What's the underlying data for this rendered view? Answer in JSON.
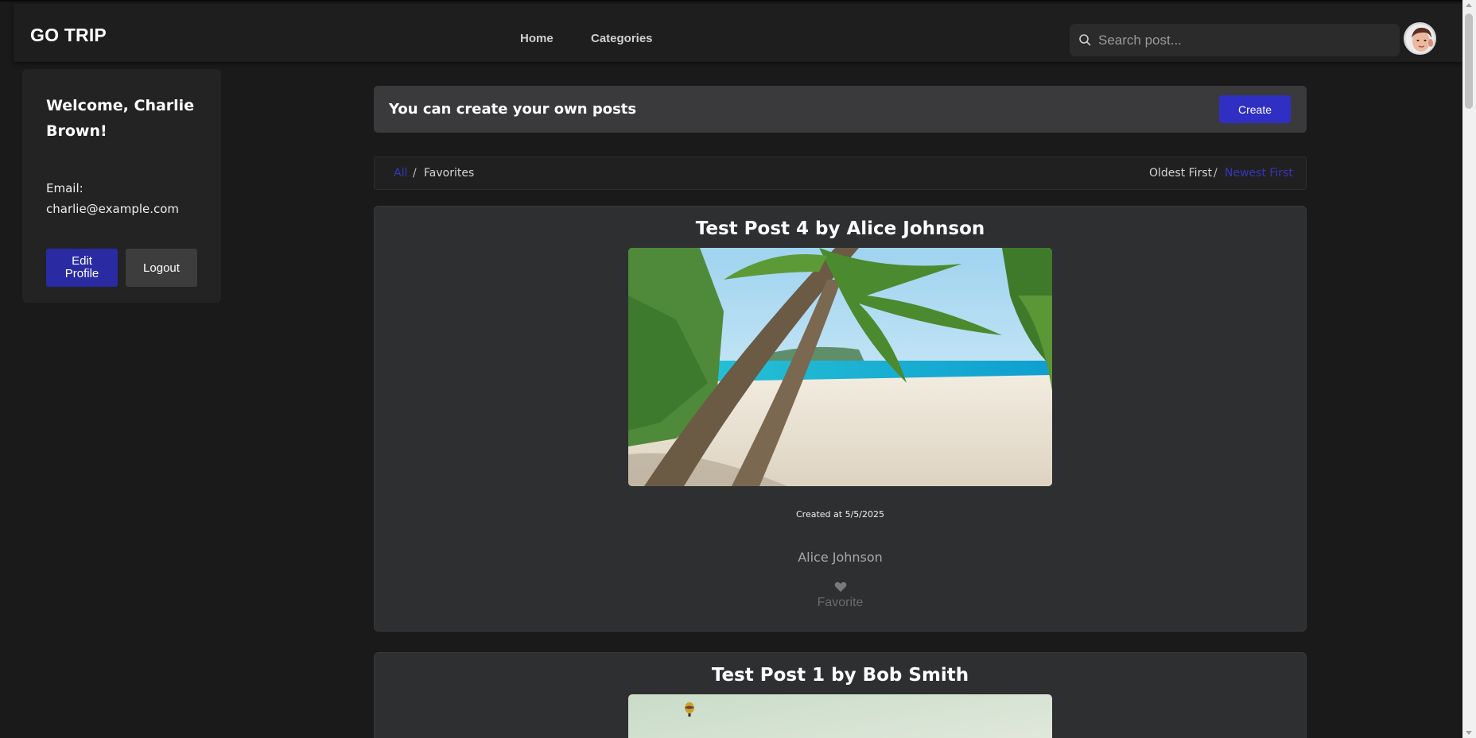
{
  "header": {
    "logo": "GO TRIP",
    "nav": [
      {
        "label": "Home"
      },
      {
        "label": "Categories"
      }
    ],
    "search": {
      "placeholder": "Search post...",
      "value": ""
    }
  },
  "sidebar": {
    "welcome": "Welcome, Charlie Brown!",
    "email_label": "Email:",
    "email": "charlie@example.com",
    "edit_label": "Edit Profile",
    "logout_label": "Logout"
  },
  "banner": {
    "text": "You can create your own posts",
    "create_label": "Create"
  },
  "filters": {
    "all": "All",
    "separator": "/",
    "favorites": "Favorites",
    "oldest": "Oldest First",
    "newest": "Newest First",
    "active_filter": "All",
    "active_sort": "Newest First"
  },
  "posts": [
    {
      "title": "Test Post 4 by Alice Johnson",
      "created": "Created at 5/5/2025",
      "author": "Alice Johnson",
      "favorite_label": "Favorite",
      "image": "tropical-beach-palm-trees"
    },
    {
      "title": "Test Post 1 by Bob Smith",
      "image": "hot-air-balloon-sky"
    }
  ],
  "colors": {
    "accent": "#2f2fc4",
    "edit_button": "#2a2aa3",
    "active_link": "#3636b8",
    "background": "#1a1a1b",
    "card": "#2e2f31"
  }
}
